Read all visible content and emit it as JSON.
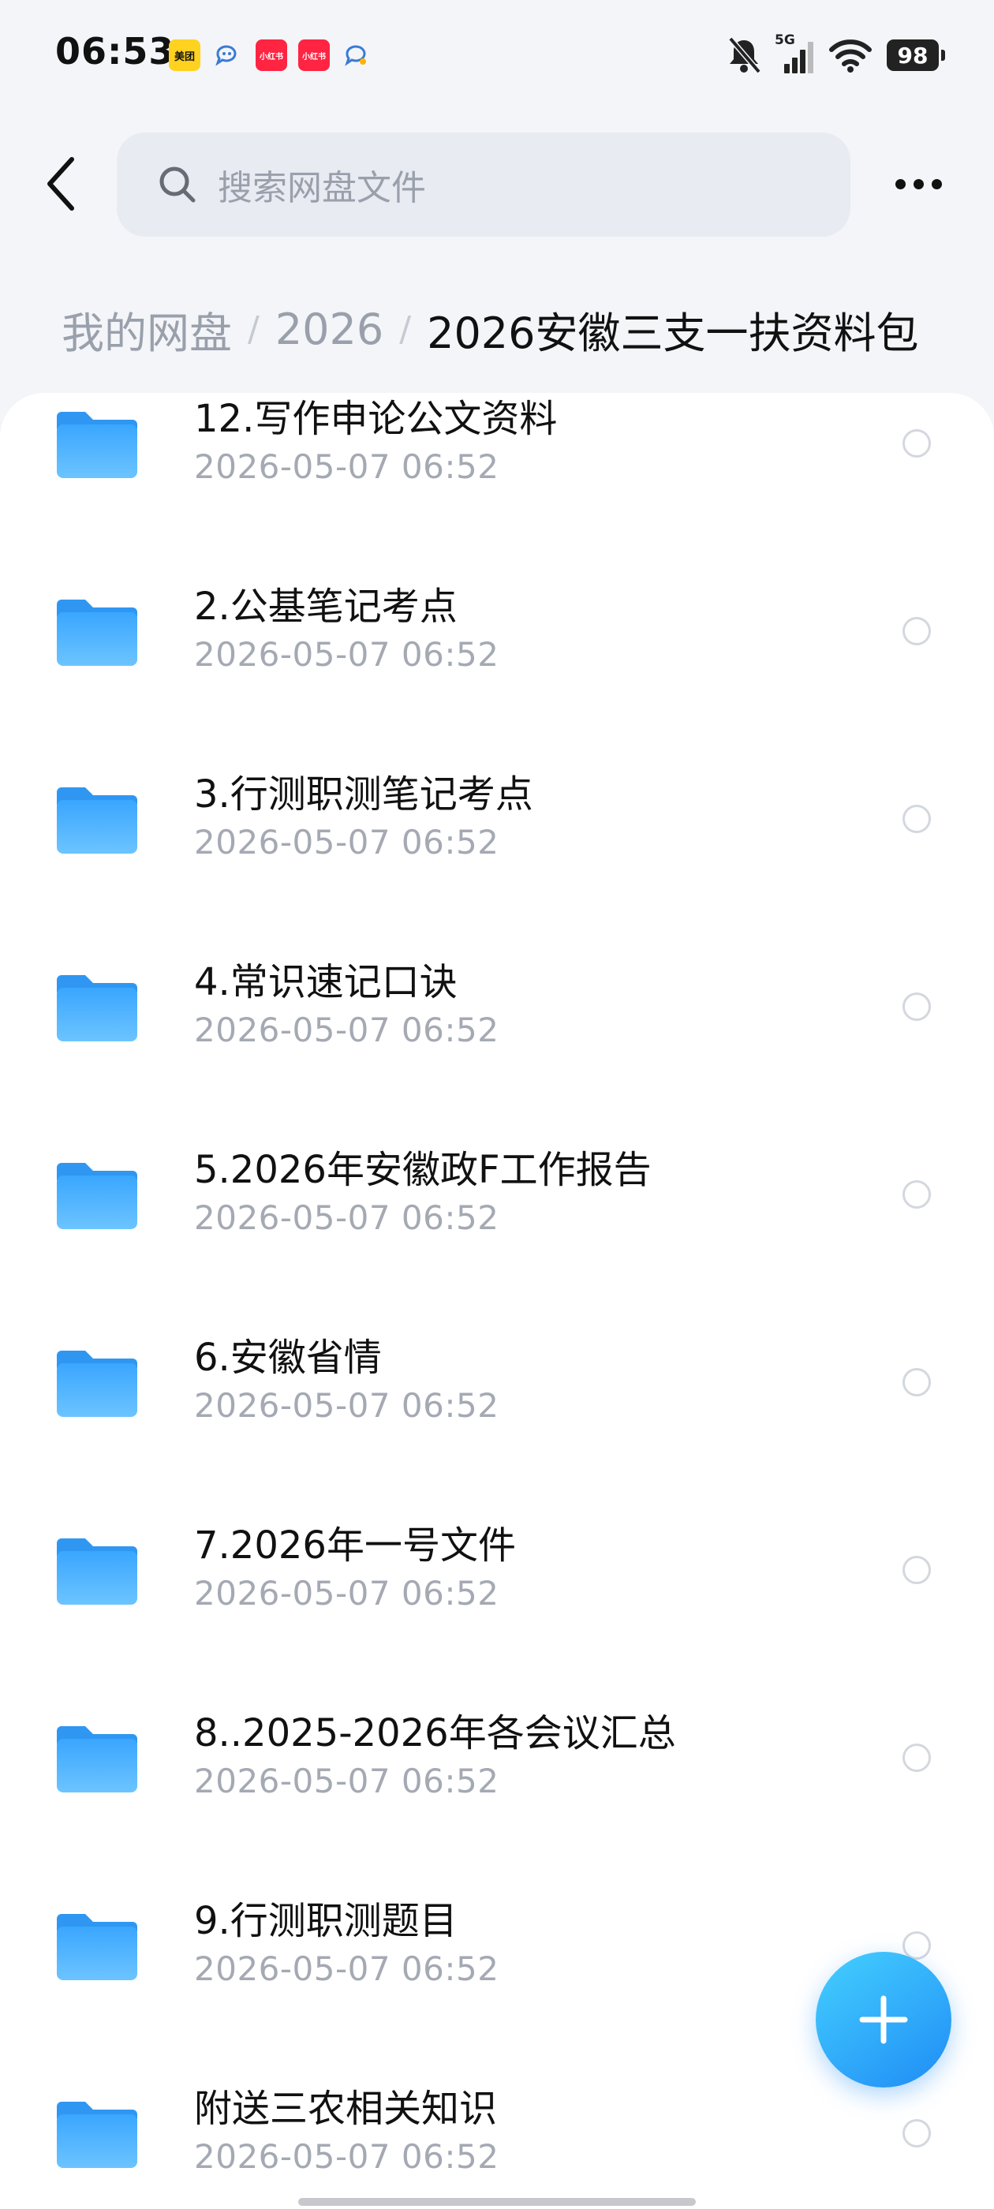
{
  "status_bar": {
    "time": "06:53",
    "notification_icons": [
      "meituan-icon",
      "chat-bubble-icon",
      "xiaohongshu-icon",
      "xiaohongshu-icon",
      "chat-bubble-icon"
    ],
    "meituan_label": "美团",
    "xhs_label": "小红书",
    "network": "5G",
    "battery": "98"
  },
  "header": {
    "search_placeholder": "搜索网盘文件"
  },
  "breadcrumb": [
    "我的网盘",
    "2026",
    "2026安徽三支一扶资料包"
  ],
  "colors": {
    "accent": "#2f9bff",
    "folder": "#4fb3ff",
    "muted_text": "#a4a9b3"
  },
  "files": [
    {
      "name": "12.写作申论公文资料",
      "time": "2026-05-07  06:52",
      "icon": "folder-icon"
    },
    {
      "name": "2.公基笔记考点",
      "time": "2026-05-07  06:52",
      "icon": "folder-icon"
    },
    {
      "name": "3.行测职测笔记考点",
      "time": "2026-05-07  06:52",
      "icon": "folder-icon"
    },
    {
      "name": "4.常识速记口诀",
      "time": "2026-05-07  06:52",
      "icon": "folder-icon"
    },
    {
      "name": "5.2026年安徽政F工作报告",
      "time": "2026-05-07  06:52",
      "icon": "folder-icon"
    },
    {
      "name": "6.安徽省情",
      "time": "2026-05-07  06:52",
      "icon": "folder-icon"
    },
    {
      "name": "7.2026年一号文件",
      "time": "2026-05-07  06:52",
      "icon": "folder-icon"
    },
    {
      "name": "8..2025-2026年各会议汇总",
      "time": "2026-05-07  06:52",
      "icon": "folder-icon"
    },
    {
      "name": "9.行测职测题目",
      "time": "2026-05-07  06:52",
      "icon": "folder-icon"
    },
    {
      "name": "附送三农相关知识",
      "time": "2026-05-07  06:52",
      "icon": "folder-icon"
    }
  ],
  "fab": {
    "icon": "plus-icon"
  }
}
